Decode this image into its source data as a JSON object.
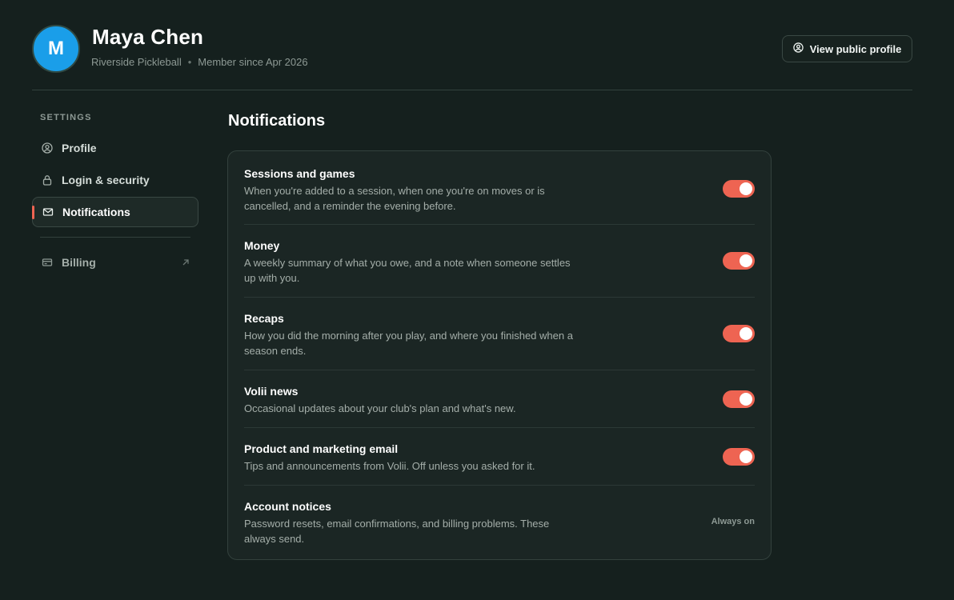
{
  "user": {
    "initial": "M",
    "name": "Maya Chen",
    "club": "Riverside Pickleball",
    "separator": "•",
    "member_since": "Member since Apr 2026"
  },
  "header": {
    "public_profile_label": "View public profile"
  },
  "sidebar": {
    "heading": "SETTINGS",
    "items": [
      {
        "label": "Profile",
        "icon": "user-circle-icon"
      },
      {
        "label": "Login & security",
        "icon": "lock-icon"
      },
      {
        "label": "Notifications",
        "icon": "mail-icon",
        "active": true
      },
      {
        "label": "Billing",
        "icon": "card-icon",
        "external": true
      }
    ]
  },
  "main": {
    "title": "Notifications",
    "rows": [
      {
        "title": "Sessions and games",
        "desc": "When you're added to a session, when one you're on moves or is cancelled, and a reminder the evening before.",
        "enabled": true
      },
      {
        "title": "Money",
        "desc": "A weekly summary of what you owe, and a note when someone settles up with you.",
        "enabled": true
      },
      {
        "title": "Recaps",
        "desc": "How you did the morning after you play, and where you finished when a season ends.",
        "enabled": true
      },
      {
        "title": "Volii news",
        "desc": "Occasional updates about your club's plan and what's new.",
        "enabled": true
      },
      {
        "title": "Product and marketing email",
        "desc": "Tips and announcements from Volii. Off unless you asked for it.",
        "enabled": true
      },
      {
        "title": "Account notices",
        "desc": "Password resets, email confirmations, and billing problems. These always send.",
        "status": "Always on"
      }
    ]
  },
  "colors": {
    "accent": "#ee6452",
    "avatar": "#1a9ee9",
    "background": "#15201e"
  }
}
